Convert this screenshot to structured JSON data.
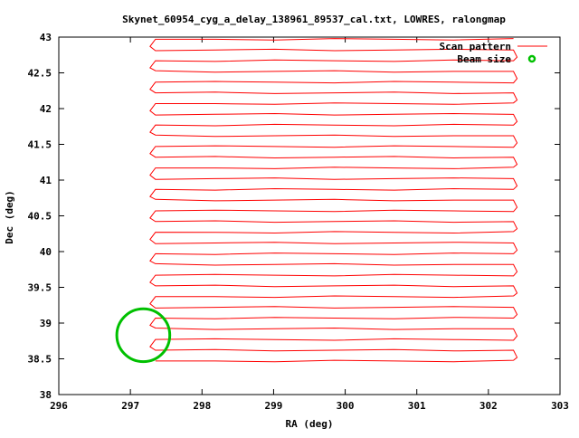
{
  "chart_data": {
    "type": "line",
    "title": "Skynet_60954_cyg_a_delay_138961_89537_cal.txt, LOWRES, ralongmap",
    "xlabel": "RA (deg)",
    "ylabel": "Dec (deg)",
    "xlim": [
      296,
      303
    ],
    "ylim": [
      38,
      43
    ],
    "xticks": [
      "296",
      "297",
      "298",
      "299",
      "300",
      "301",
      "302",
      "303"
    ],
    "yticks": [
      "38",
      "38.5",
      "39",
      "39.5",
      "40",
      "40.5",
      "41",
      "41.5",
      "42",
      "42.5",
      "43"
    ],
    "legend": {
      "position": "top-right",
      "entries": [
        {
          "label": "Scan pattern",
          "color": "#ff0000"
        },
        {
          "label": "Beam size",
          "color": "#00c000"
        }
      ]
    },
    "scan": {
      "ra_start": 297.35,
      "ra_end": 302.35,
      "dec_start": 38.47,
      "dec_step": 0.15,
      "rows": 31
    },
    "beam": {
      "ra": 297.18,
      "dec": 38.83,
      "radius_deg": 0.37
    }
  }
}
